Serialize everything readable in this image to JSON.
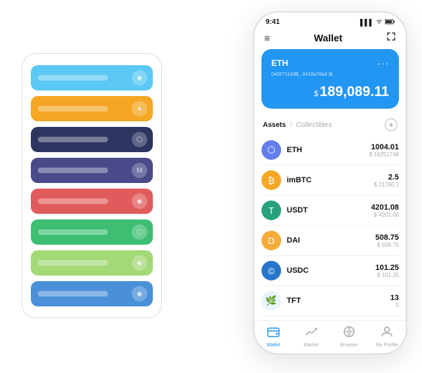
{
  "scene": {
    "cardStack": {
      "cards": [
        {
          "color": "#5BC8F5",
          "iconChar": "◆"
        },
        {
          "color": "#F5A623",
          "iconChar": "●"
        },
        {
          "color": "#2D3561",
          "iconChar": "⬡"
        },
        {
          "color": "#4A4A8A",
          "iconChar": "M"
        },
        {
          "color": "#E05C5C",
          "iconChar": "◆"
        },
        {
          "color": "#3DBE72",
          "iconChar": "⬡"
        },
        {
          "color": "#A3D977",
          "iconChar": "◆"
        },
        {
          "color": "#4A90D9",
          "iconChar": "◆"
        }
      ]
    },
    "phone": {
      "statusBar": {
        "time": "9:41",
        "signal": "▌▌▌",
        "wifi": "WiFi",
        "battery": "▐"
      },
      "header": {
        "menuIcon": "≡",
        "title": "Wallet",
        "expandIcon": "⤢"
      },
      "walletCard": {
        "label": "ETH",
        "dotsMenu": "···",
        "address": "0x08711d3B...8418a78a3  ⊞",
        "currencySymbol": "$",
        "amount": "189,089.11"
      },
      "assetsTabs": {
        "active": "Assets",
        "divider": "/",
        "inactive": "Collectibles",
        "addLabel": "+"
      },
      "assets": [
        {
          "name": "ETH",
          "iconChar": "⬡",
          "iconClass": "eth-icon",
          "amountPrimary": "1004.01",
          "amountUsd": "$ 16251748"
        },
        {
          "name": "imBTC",
          "iconChar": "₿",
          "iconClass": "imbtc-icon",
          "amountPrimary": "2.5",
          "amountUsd": "$ 21760.1"
        },
        {
          "name": "USDT",
          "iconChar": "T",
          "iconClass": "usdt-icon",
          "amountPrimary": "4201.08",
          "amountUsd": "$ 4201.08"
        },
        {
          "name": "DAI",
          "iconChar": "D",
          "iconClass": "dai-icon",
          "amountPrimary": "508.75",
          "amountUsd": "$ 508.75"
        },
        {
          "name": "USDC",
          "iconChar": "©",
          "iconClass": "usdc-icon",
          "amountPrimary": "101.25",
          "amountUsd": "$ 101.25"
        },
        {
          "name": "TFT",
          "iconChar": "🌿",
          "iconClass": "tft-icon",
          "amountPrimary": "13",
          "amountUsd": "0"
        }
      ],
      "bottomNav": [
        {
          "icon": "👛",
          "label": "Wallet",
          "active": true
        },
        {
          "icon": "📈",
          "label": "Market",
          "active": false
        },
        {
          "icon": "🌐",
          "label": "Browser",
          "active": false
        },
        {
          "icon": "👤",
          "label": "My Profile",
          "active": false
        }
      ]
    }
  }
}
